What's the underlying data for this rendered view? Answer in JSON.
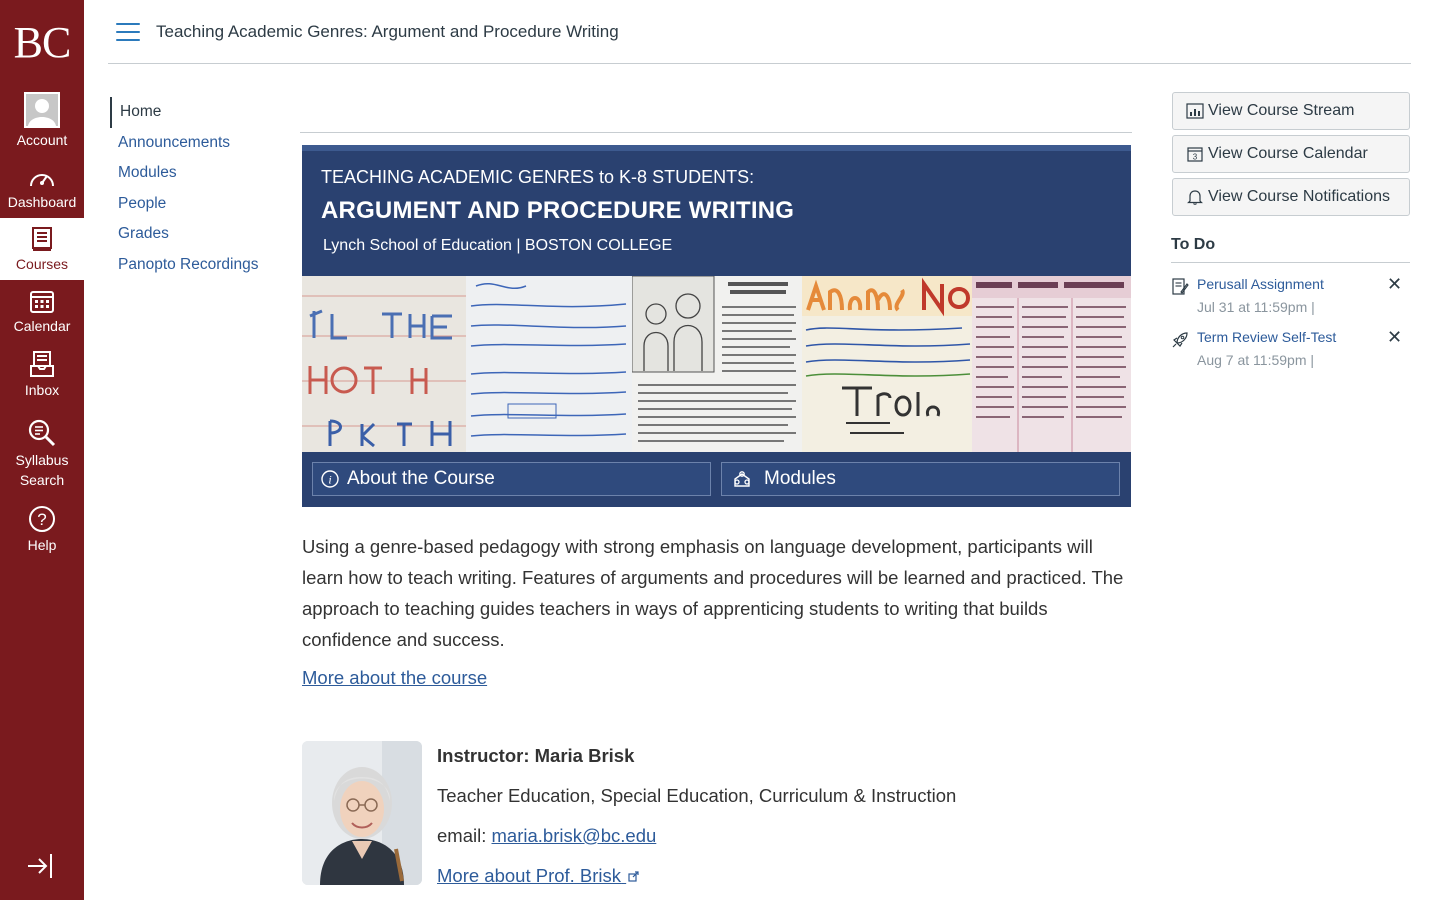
{
  "global_nav": {
    "logo": "BC",
    "items": [
      {
        "label": "Account",
        "icon": "account-avatar-icon"
      },
      {
        "label": "Dashboard",
        "icon": "dashboard-icon"
      },
      {
        "label": "Courses",
        "icon": "courses-icon",
        "active": true
      },
      {
        "label": "Calendar",
        "icon": "calendar-icon"
      },
      {
        "label": "Inbox",
        "icon": "inbox-icon"
      },
      {
        "label": "Syllabus Search",
        "icon": "syllabus-search-icon"
      },
      {
        "label": "Help",
        "icon": "help-icon"
      }
    ],
    "brand_color": "#7a1a1e"
  },
  "header": {
    "breadcrumb": "Teaching Academic Genres: Argument and Procedure Writing"
  },
  "course_nav": {
    "items": [
      "Home",
      "Announcements",
      "Modules",
      "People",
      "Grades",
      "Panopto Recordings"
    ],
    "active": "Home"
  },
  "banner": {
    "line1": "TEACHING ACADEMIC GENRES to K-8 STUDENTS:",
    "line2": "ARGUMENT AND PROCEDURE WRITING",
    "line3": "Lynch School of Education | BOSTON COLLEGE",
    "buttons": [
      {
        "label": "About the Course",
        "icon": "info-icon"
      },
      {
        "label": "Modules",
        "icon": "modules-icon"
      }
    ],
    "color": "#2a4170"
  },
  "main": {
    "description": "Using a genre-based pedagogy with strong emphasis on language development, participants will learn how to teach writing. Features of arguments and procedures will be learned and practiced. The approach to teaching guides teachers in ways of apprenticing students to writing that builds confidence and success.",
    "more_course_link": "More about the course"
  },
  "instructor": {
    "title": "Instructor: Maria Brisk",
    "department": "Teacher Education, Special Education, Curriculum & Instruction",
    "email_label": "email: ",
    "email": "maria.brisk@bc.edu",
    "more_link": "More about Prof. Brisk"
  },
  "sidebar": {
    "buttons": [
      {
        "label": "View Course Stream",
        "icon": "stream-icon"
      },
      {
        "label": "View Course Calendar",
        "icon": "calendar-icon"
      },
      {
        "label": "View Course Notifications",
        "icon": "bell-icon"
      }
    ],
    "todo_heading": "To Do",
    "todo": [
      {
        "name": "Perusall Assignment",
        "due": "Jul 31 at 11:59pm  |",
        "icon": "assignment-icon"
      },
      {
        "name": "Term Review Self-Test",
        "due": "Aug 7 at 11:59pm  |",
        "icon": "quiz-rocket-icon"
      }
    ]
  }
}
